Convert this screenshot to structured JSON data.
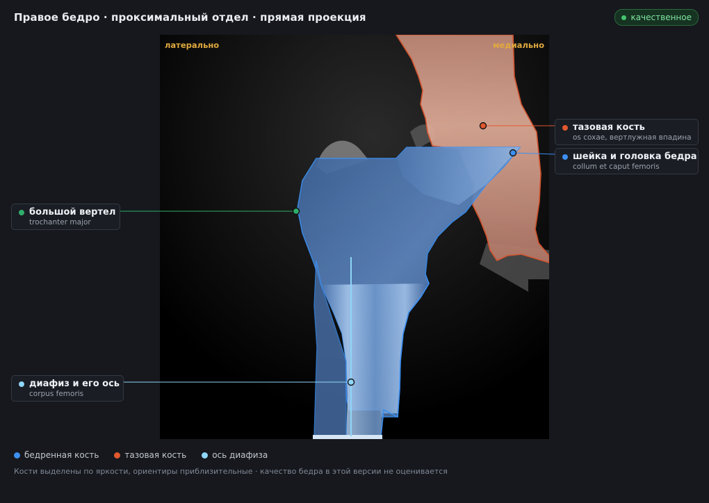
{
  "header": {
    "title": "Правое бедро · проксимальный отдел · прямая проекция",
    "badge": "качественное"
  },
  "viewer": {
    "orientation_left": "латерально",
    "orientation_right": "медиально"
  },
  "callouts": {
    "pelvis": {
      "name": "тазовая кость",
      "latin": "os coxae, вертлужная впадина",
      "color": "#e0572e"
    },
    "neck": {
      "name": "шейка и головка бедра",
      "latin": "collum et caput femoris",
      "color": "#3c8ff0"
    },
    "trochanter": {
      "name": "большой вертел",
      "latin": "trochanter major",
      "color": "#2fae6b"
    },
    "shaft": {
      "name": "диафиз и его ось",
      "latin": "corpus femoris",
      "color": "#8fd6f7"
    }
  },
  "legend": [
    {
      "label": "бедренная кость",
      "color": "#3c8ff0"
    },
    {
      "label": "тазовая кость",
      "color": "#e0572e"
    },
    {
      "label": "ось диафиза",
      "color": "#8fd6f7"
    }
  ],
  "footnote": "Кости выделены по яркости, ориентиры приблизительные · качество бедра в этой версии не оценивается"
}
